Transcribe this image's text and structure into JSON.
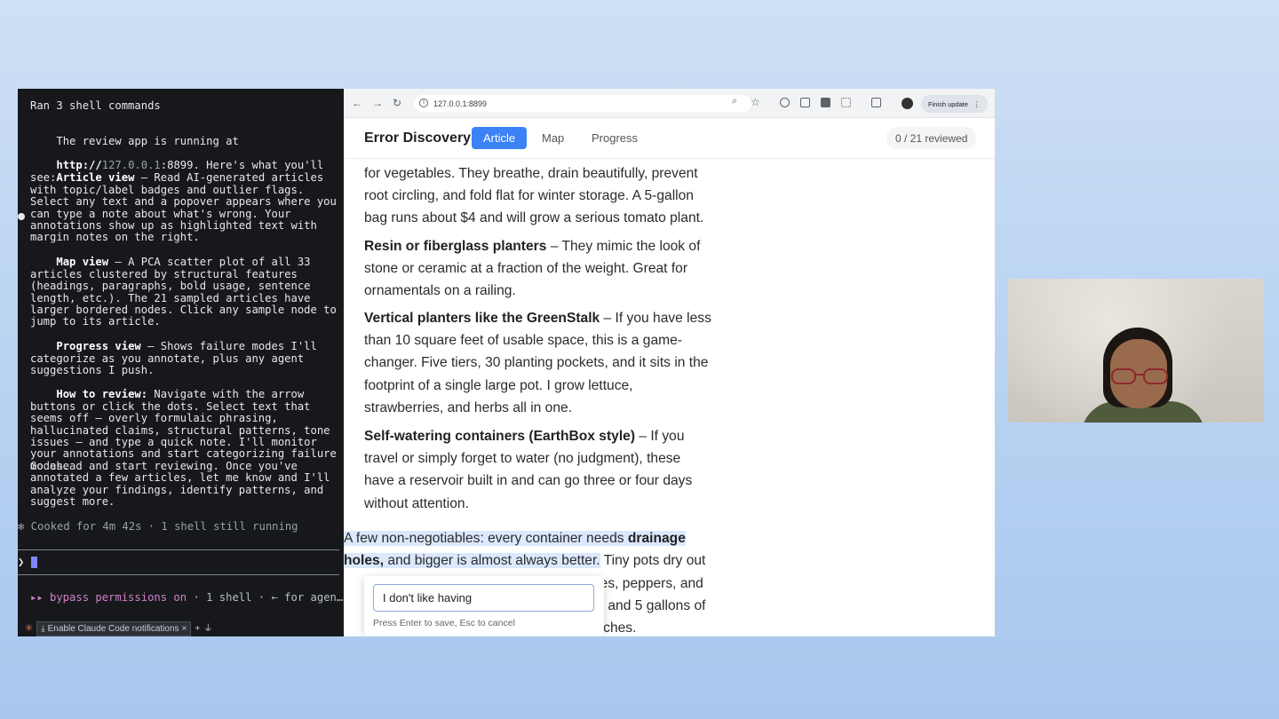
{
  "terminal": {
    "header": "Ran 3 shell commands",
    "intro_line1": "The review app is running at",
    "intro_url_prefix": "http://",
    "intro_url_host": "127.0.0.1",
    "intro_url_rest": ":8899. Here's what you'll see:",
    "article_view_label": "Article view",
    "article_view_text": " — Read AI-generated articles with topic/label badges and outlier flags. Select any text and a popover appears where you can type a note about what's wrong. Your annotations show up as highlighted text with margin notes on the right.",
    "map_view_label": "Map view",
    "map_view_text": " — A PCA scatter plot of all 33 articles clustered by structural features (headings, paragraphs, bold usage, sentence length, etc.). The 21 sampled articles have larger bordered nodes. Click any sample node to jump to its article.",
    "progress_view_label": "Progress view",
    "progress_view_text": " — Shows failure modes I'll categorize as you annotate, plus any agent suggestions I push.",
    "how_to_label": "How to review:",
    "how_to_text": " Navigate with the arrow buttons or click the dots. Select text that seems off — overly formulaic phrasing, hallucinated claims, structural patterns, tone issues — and type a quick note. I'll monitor your annotations and start categorizing failure modes.",
    "closing_text": "Go ahead and start reviewing. Once you've annotated a few articles, let me know and I'll analyze your findings, identify patterns, and suggest more.",
    "status_line": "✻ Cooked for 4m 42s · 1 shell still running",
    "prompt_char": "❯",
    "bypass_text": "▸▸ bypass permissions on",
    "bypass_rest": " · 1 shell · ← for agen…",
    "notification_button": "Enable Claude Code notifications",
    "notification_close": "×",
    "notification_plus": "+"
  },
  "browser": {
    "url": "127.0.0.1:8899",
    "finish_update": "Finish update",
    "brand": "Error Discovery",
    "tabs": [
      {
        "label": "Article",
        "active": true
      },
      {
        "label": "Map",
        "active": false
      },
      {
        "label": "Progress",
        "active": false
      }
    ],
    "reviewed_count": "0 / 21 reviewed"
  },
  "article": {
    "p0_lines": [
      "for vegetables. They breathe, drain beautifully, prevent",
      "root circling, and fold flat for winter storage. A 5-gallon",
      "bag runs about $4 and will grow a serious tomato plant."
    ],
    "p1_bold": "Resin or fiberglass planters",
    "p1_text": " – They mimic the look of stone or ceramic at a fraction of the weight. Great for ornamentals on a railing.",
    "p2_bold": "Vertical planters like the GreenStalk",
    "p2_text": " – If you have less than 10 square feet of usable space, this is a game-changer. Five tiers, 30 planting pockets, and it sits in the footprint of a single large pot. I grow lettuce, strawberries, and herbs all in one.",
    "p3_bold": "Self-watering containers (EarthBox style)",
    "p3_text": " – If you travel or simply forget to water (no judgment), these have a reservoir built in and can go three or four days without attention.",
    "p4_hl_start": "A few non-negotiables: every container needs ",
    "p4_hl_bold": "drainage holes,",
    "p4_hl_end": " and bigger is almost always better.",
    "p4_rest_line1": " Tiny pots dry out",
    "p4_partial_line2": "atoes, peppers, and",
    "p4_partial_line3": "eep and 5 gallons of",
    "p4_partial_line4": "8 inches."
  },
  "popover": {
    "value": "I don't like having",
    "hint": "Press Enter to save, Esc to cancel"
  }
}
